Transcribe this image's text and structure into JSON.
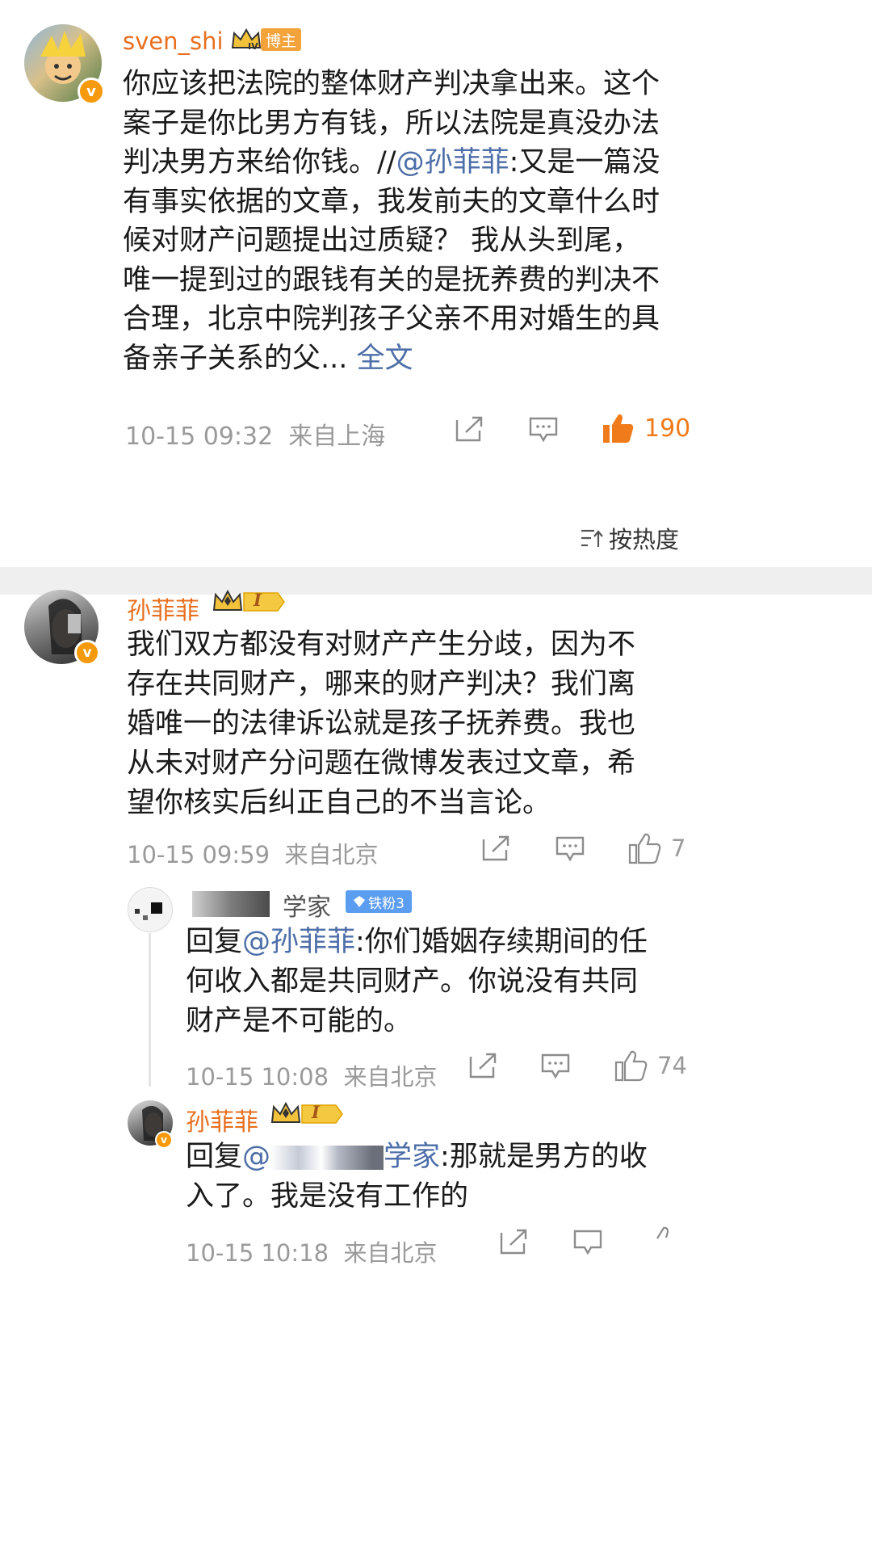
{
  "post": {
    "username": "sven_shi",
    "badge_label": "博主",
    "text_lines": [
      "你应该把法院的整体财产判决拿出来。这个",
      "案子是你比男方有钱，所以法院是真没办法",
      "判决男方来给你钱。//",
      "有事实依据的文章，我发前夫的文章什么时",
      "候对财产问题提出过质疑？ 我从头到尾，",
      "唯一提到过的跟钱有关的是抚养费的判决不",
      "合理，北京中院判孩子父亲不用对婚生的具",
      "备亲子关系的父..."
    ],
    "mention": "@孙菲菲",
    "mention_tail": ":又是一篇没",
    "full_text_link": "全文",
    "time": "10-15 09:32",
    "location": "来自上海",
    "like_count": "190"
  },
  "sort": {
    "label": "按热度"
  },
  "comments": [
    {
      "username": "孙菲菲",
      "level_label": "I",
      "text_lines": [
        "我们双方都没有对财产产生分歧，因为不",
        "存在共同财产，哪来的财产判决？我们离",
        "婚唯一的法律诉讼就是孩子抚养费。我也",
        "从未对财产分问题在微博发表过文章，希",
        "望你核实后纠正自己的不当言论。"
      ],
      "time": "10-15 09:59",
      "location": "来自北京",
      "like_count": "7"
    }
  ],
  "replies": [
    {
      "username": "学家",
      "fan_badge": "铁粉3",
      "prefix": "回复",
      "mention": "@孙菲菲",
      "text_first": ":你们婚姻存续期间的任",
      "text_lines": [
        "何收入都是共同财产。你说没有共同",
        "财产是不可能的。"
      ],
      "time": "10-15 10:08",
      "location": "来自北京",
      "like_count": "74"
    },
    {
      "username": "孙菲菲",
      "level_label": "I",
      "prefix": "回复",
      "mention_start": "@",
      "mention_end": "学家",
      "text_first": ":那就是男方的收",
      "text_lines": [
        "入了。我是没有工作的"
      ],
      "time": "10-15 10:18",
      "location": "来自北京"
    }
  ],
  "colors": {
    "username": "#e86f1f",
    "link": "#4d6ea8",
    "meta": "#9a9a9a",
    "like_active": "#f07b1a",
    "badge_orange": "#f59a0c"
  }
}
